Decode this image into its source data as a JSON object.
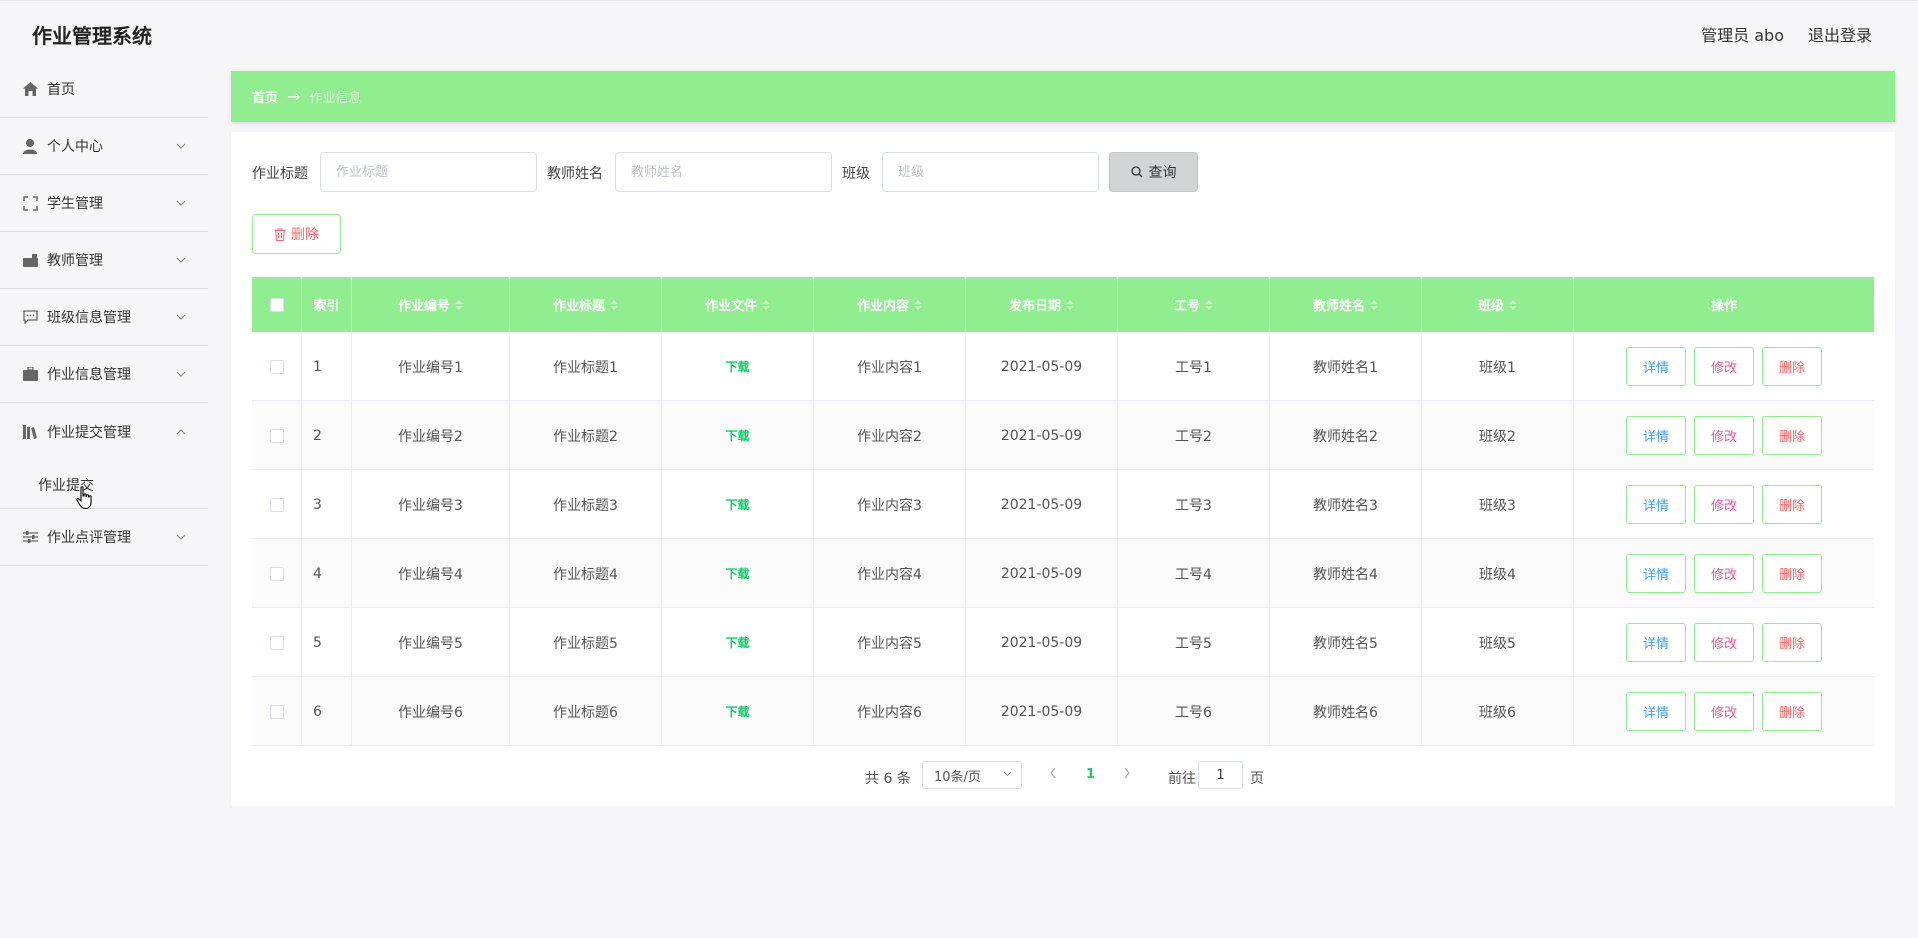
{
  "app": {
    "title": "作业管理系统"
  },
  "header": {
    "user": "管理员 abo",
    "logout": "退出登录"
  },
  "sidebar": {
    "items": [
      {
        "label": "首页",
        "icon": "home-icon"
      },
      {
        "label": "个人中心",
        "icon": "user-icon"
      },
      {
        "label": "学生管理",
        "icon": "scan-icon"
      },
      {
        "label": "教师管理",
        "icon": "briefcase-icon"
      },
      {
        "label": "班级信息管理",
        "icon": "chat-icon"
      },
      {
        "label": "作业信息管理",
        "icon": "suitcase-icon"
      },
      {
        "label": "作业提交管理",
        "icon": "library-icon",
        "expanded": true
      },
      {
        "label": "作业点评管理",
        "icon": "sliders-icon"
      }
    ],
    "sub_items": [
      {
        "label": "作业提交"
      }
    ]
  },
  "breadcrumb": {
    "home": "首页",
    "current": "作业信息"
  },
  "filters": {
    "title_label": "作业标题",
    "title_placeholder": "作业标题",
    "title_value": "",
    "teacher_label": "教师姓名",
    "teacher_placeholder": "教师姓名",
    "teacher_value": "",
    "class_label": "班级",
    "class_placeholder": "班级",
    "class_value": ""
  },
  "actions": {
    "search": "查询",
    "delete": "删除"
  },
  "table": {
    "columns": [
      "索引",
      "作业编号",
      "作业标题",
      "作业文件",
      "作业内容",
      "发布日期",
      "工号",
      "教师姓名",
      "班级",
      "操作"
    ],
    "rows": [
      {
        "index": "1",
        "code": "作业编号1",
        "title": "作业标题1",
        "file": "下载",
        "content": "作业内容1",
        "date": "2021-05-09",
        "staff_id": "工号1",
        "teacher": "教师姓名1",
        "class": "班级1"
      },
      {
        "index": "2",
        "code": "作业编号2",
        "title": "作业标题2",
        "file": "下载",
        "content": "作业内容2",
        "date": "2021-05-09",
        "staff_id": "工号2",
        "teacher": "教师姓名2",
        "class": "班级2"
      },
      {
        "index": "3",
        "code": "作业编号3",
        "title": "作业标题3",
        "file": "下载",
        "content": "作业内容3",
        "date": "2021-05-09",
        "staff_id": "工号3",
        "teacher": "教师姓名3",
        "class": "班级3"
      },
      {
        "index": "4",
        "code": "作业编号4",
        "title": "作业标题4",
        "file": "下载",
        "content": "作业内容4",
        "date": "2021-05-09",
        "staff_id": "工号4",
        "teacher": "教师姓名4",
        "class": "班级4"
      },
      {
        "index": "5",
        "code": "作业编号5",
        "title": "作业标题5",
        "file": "下载",
        "content": "作业内容5",
        "date": "2021-05-09",
        "staff_id": "工号5",
        "teacher": "教师姓名5",
        "class": "班级5"
      },
      {
        "index": "6",
        "code": "作业编号6",
        "title": "作业标题6",
        "file": "下载",
        "content": "作业内容6",
        "date": "2021-05-09",
        "staff_id": "工号6",
        "teacher": "教师姓名6",
        "class": "班级6"
      }
    ],
    "row_actions": {
      "detail": "详情",
      "edit": "修改",
      "delete": "删除"
    }
  },
  "pagination": {
    "total": "共 6 条",
    "page_size": "10条/页",
    "current_page": "1",
    "goto_prefix": "前往",
    "goto_value": "1",
    "goto_suffix": "页"
  },
  "colors": {
    "accent": "#90ee90",
    "link": "#13ce66",
    "danger": "#f56c6c",
    "detail": "#409eff",
    "edit": "#e85a9a"
  }
}
